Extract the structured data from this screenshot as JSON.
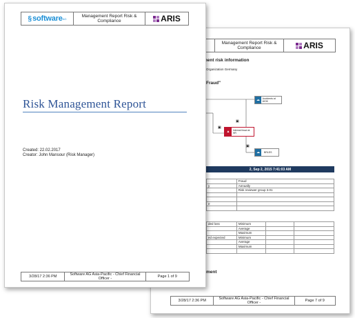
{
  "front_page": {
    "header": {
      "logo_left": "software",
      "logo_left_suffix": "AG",
      "title": "Management Report Risk & Compliance",
      "logo_right": "ARIS"
    },
    "title": "Risk Management Report",
    "created": "Created: 22.02.2017",
    "creator": "Creator: John Mansour (Risk Manager)",
    "footer": {
      "date": "3/28/17 2:36 PM",
      "company": "Software AG Asia-Pacific - Chief Financial Officer -",
      "page": "Page 1 of 9"
    }
  },
  "back_page": {
    "header": {
      "logo_left": "ware",
      "logo_left_suffix": "AG",
      "title": "Management Report Risk & Compliance",
      "logo_right": "ARIS"
    },
    "section_title": "ment risk information",
    "org": "Organization Germany",
    "fraud_heading": "Fraud\"",
    "diagram": {
      "node_top": "Accidents at WOK",
      "node_mid": "Internal fraud at HR",
      "node_bottom": "BRLES"
    },
    "date_bar": "2, Sep 2, 2015 7:41:03 AM",
    "table1": {
      "rows": [
        [
          "",
          "Fraud"
        ],
        [
          "y",
          "Annually"
        ],
        [
          "",
          "Risk reviewer group 3.01"
        ],
        [
          "",
          ""
        ],
        [
          "",
          ""
        ],
        [
          "e",
          ""
        ],
        [
          "",
          ""
        ]
      ]
    },
    "table2": {
      "rows": [
        [
          "ded loss",
          "Minimum",
          "",
          ""
        ],
        [
          "",
          "Average",
          "",
          ""
        ],
        [
          "",
          "Maximum",
          "",
          ""
        ],
        [
          "ed expected",
          "Minimum",
          "",
          ""
        ],
        [
          "",
          "Average",
          "",
          ""
        ],
        [
          "",
          "Maximum",
          "",
          ""
        ],
        [
          "",
          "",
          "",
          ""
        ]
      ]
    },
    "bottom_heading": "ment",
    "footer": {
      "date": "3/28/17 2:36 PM",
      "company": "Software AG Asia-Pacific - Chief Financial Officer -",
      "page": "Page 7 of 9"
    }
  },
  "colors": {
    "software_blue": "#1c8fd6",
    "title_blue": "#2e5496",
    "dark_bar": "#1f3a5f",
    "fraud_red": "#c0142e",
    "node_teal": "#1f6fa3"
  }
}
